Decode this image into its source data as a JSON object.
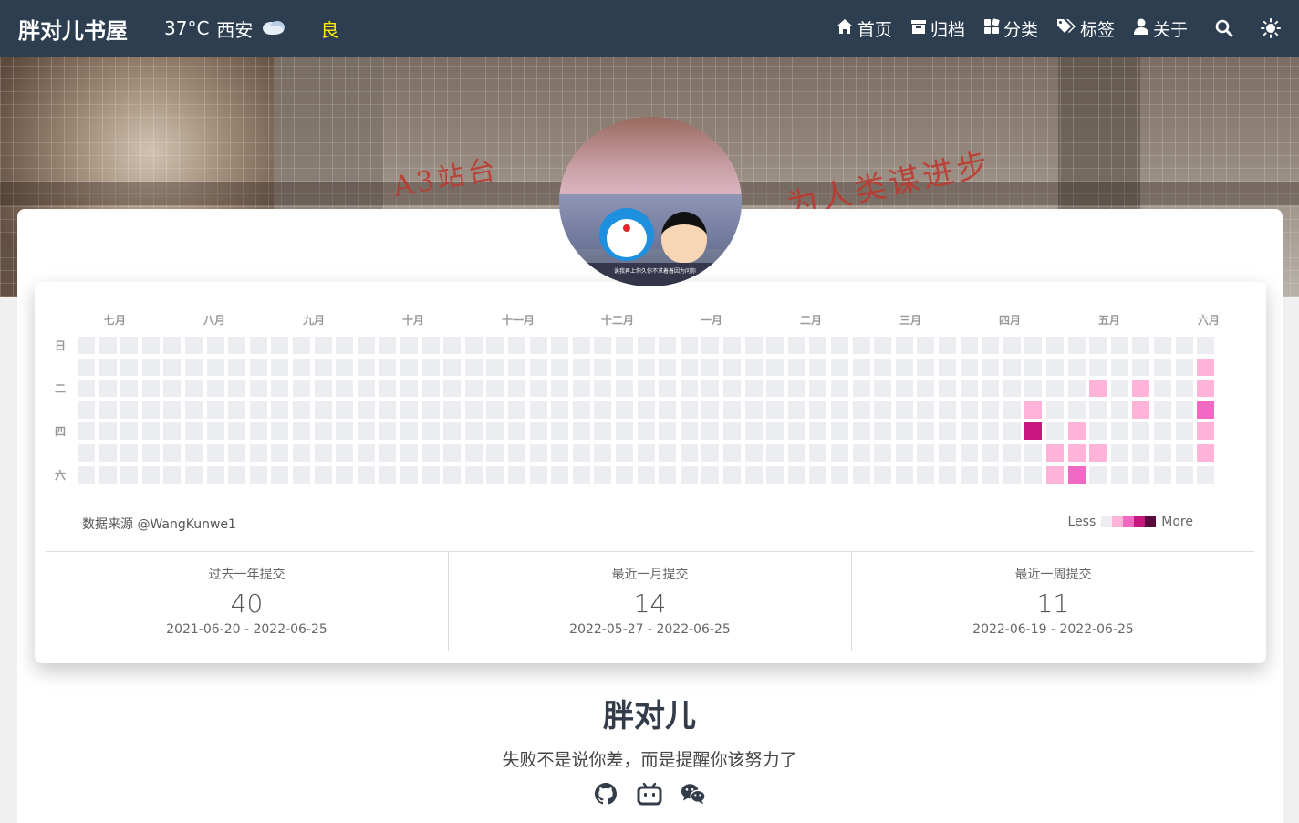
{
  "navbar": {
    "brand": "胖对儿书屋",
    "weather": {
      "temperature": "37°C",
      "city": "西安",
      "icon": "cloud-icon"
    },
    "aqi": "良",
    "menu": [
      {
        "label": "首页",
        "icon": "home-icon"
      },
      {
        "label": "归档",
        "icon": "archive-icon"
      },
      {
        "label": "分类",
        "icon": "category-icon"
      },
      {
        "label": "标签",
        "icon": "tags-icon"
      },
      {
        "label": "关于",
        "icon": "user-icon"
      }
    ],
    "search_icon": "search-icon",
    "theme_icon": "sun-icon"
  },
  "hero": {
    "slogan_left": "A3站台",
    "slogan_right": "为人类谋进步"
  },
  "avatar": {
    "caption": "诶我再上你久你不求着着因为问你"
  },
  "contributions": {
    "months": [
      "七月",
      "八月",
      "九月",
      "十月",
      "十一月",
      "十二月",
      "一月",
      "二月",
      "三月",
      "四月",
      "五月",
      "六月"
    ],
    "days": [
      "日",
      "二",
      "四",
      "六"
    ],
    "source": "数据来源 @WangKunwe1",
    "legend": {
      "less": "Less",
      "more": "More",
      "colors": [
        "#ebedf0",
        "#ffb3d9",
        "#f06ac4",
        "#c7177f",
        "#5a0a3c"
      ]
    },
    "weeks": 53,
    "active_cells": [
      {
        "week": 44,
        "day": 3,
        "level": 1
      },
      {
        "week": 44,
        "day": 4,
        "level": 3
      },
      {
        "week": 45,
        "day": 5,
        "level": 1
      },
      {
        "week": 45,
        "day": 6,
        "level": 1
      },
      {
        "week": 46,
        "day": 4,
        "level": 1
      },
      {
        "week": 46,
        "day": 5,
        "level": 1
      },
      {
        "week": 46,
        "day": 6,
        "level": 2
      },
      {
        "week": 47,
        "day": 2,
        "level": 1
      },
      {
        "week": 47,
        "day": 5,
        "level": 1
      },
      {
        "week": 49,
        "day": 2,
        "level": 1
      },
      {
        "week": 49,
        "day": 3,
        "level": 1
      },
      {
        "week": 52,
        "day": 1,
        "level": 1
      },
      {
        "week": 52,
        "day": 2,
        "level": 1
      },
      {
        "week": 52,
        "day": 3,
        "level": 2
      },
      {
        "week": 52,
        "day": 4,
        "level": 1
      },
      {
        "week": 52,
        "day": 5,
        "level": 1
      }
    ],
    "stats": [
      {
        "title": "过去一年提交",
        "value": "40",
        "range": "2021-06-20 - 2022-06-25"
      },
      {
        "title": "最近一月提交",
        "value": "14",
        "range": "2022-05-27 - 2022-06-25"
      },
      {
        "title": "最近一周提交",
        "value": "11",
        "range": "2022-06-19 - 2022-06-25"
      }
    ]
  },
  "profile": {
    "name": "胖对儿",
    "motto": "失败不是说你差，而是提醒你该努力了",
    "socials": [
      "github-icon",
      "bilibili-icon",
      "wechat-icon"
    ]
  }
}
